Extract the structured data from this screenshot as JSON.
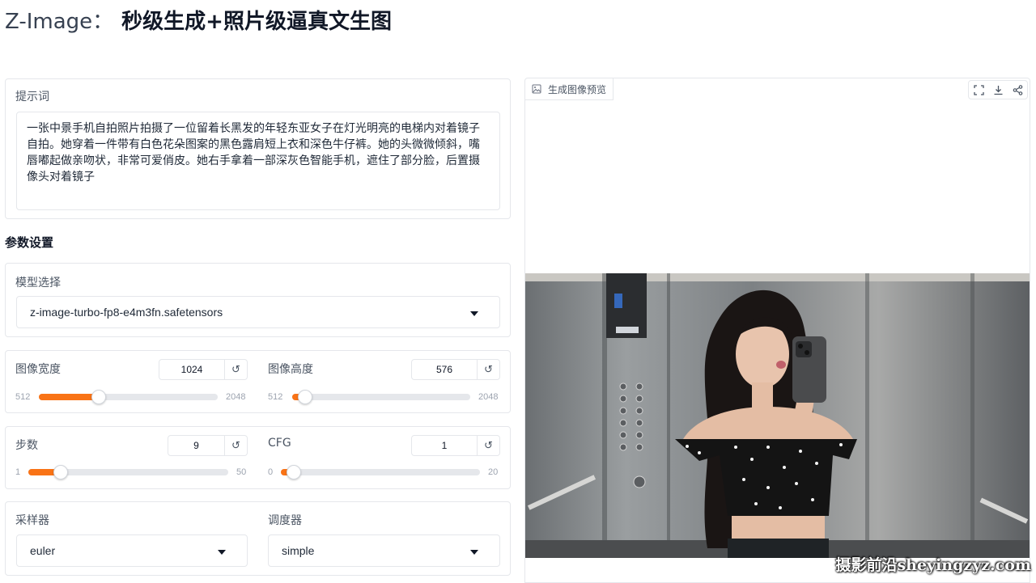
{
  "header": {
    "app_name": "Z-Image：",
    "subtitle": "秒级生成+照片级逼真文生图"
  },
  "prompt": {
    "label": "提示词",
    "value": "一张中景手机自拍照片拍摄了一位留着长黑发的年轻东亚女子在灯光明亮的电梯内对着镜子自拍。她穿着一件带有白色花朵图案的黑色露肩短上衣和深色牛仔裤。她的头微微倾斜，嘴唇嘟起做亲吻状，非常可爱俏皮。她右手拿着一部深灰色智能手机，遮住了部分脸，后置摄像头对着镜子"
  },
  "params": {
    "section_title": "参数设置",
    "model": {
      "label": "模型选择",
      "value": "z-image-turbo-fp8-e4m3fn.safetensors"
    },
    "width": {
      "label": "图像宽度",
      "value": "1024",
      "min": "512",
      "max": "2048",
      "num": 1024,
      "lo": 512,
      "hi": 2048
    },
    "height": {
      "label": "图像高度",
      "value": "576",
      "min": "512",
      "max": "2048",
      "num": 576,
      "lo": 512,
      "hi": 2048
    },
    "steps": {
      "label": "步数",
      "value": "9",
      "min": "1",
      "max": "50",
      "num": 9,
      "lo": 1,
      "hi": 50
    },
    "cfg": {
      "label": "CFG",
      "value": "1",
      "min": "0",
      "max": "20",
      "num": 1,
      "lo": 0,
      "hi": 20
    },
    "sampler": {
      "label": "采样器",
      "value": "euler"
    },
    "scheduler": {
      "label": "调度器",
      "value": "simple"
    },
    "reset_glyph": "↺"
  },
  "preview": {
    "tab_label": "生成图像预览"
  },
  "watermark": "摄影前沿sheyingzyz.com",
  "colors": {
    "accent": "#f97316",
    "border": "#e5e7eb"
  }
}
